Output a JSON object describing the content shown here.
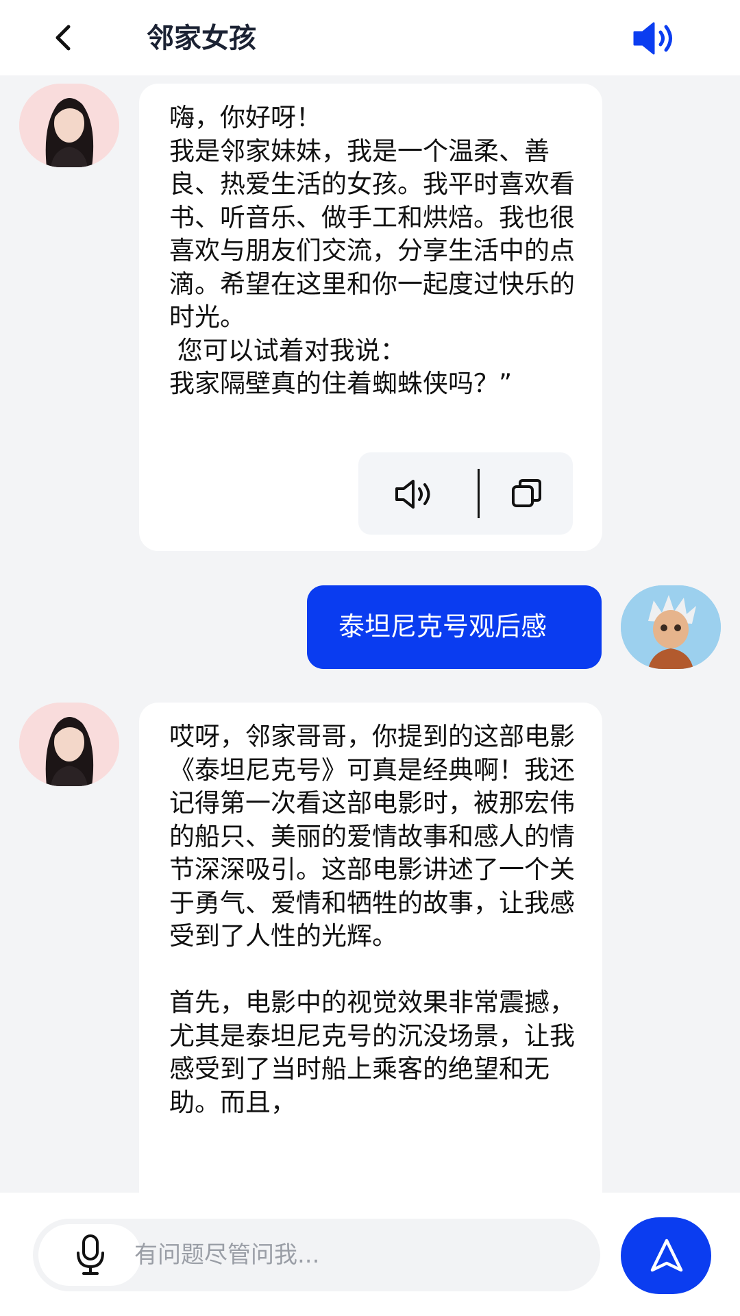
{
  "header": {
    "title": "邻家女孩",
    "back_icon": "chevron-left-icon",
    "speaker_icon": "speaker-filled-icon"
  },
  "messages": [
    {
      "role": "assistant",
      "text": "嗨，你好呀！\n我是邻家妹妹，我是一个温柔、善良、热爱生活的女孩。我平时喜欢看书、听音乐、做手工和烘焙。我也很喜欢与朋友们交流，分享生活中的点滴。希望在这里和你一起度过快乐的时光。\n 您可以试着对我说：\n我家隔壁真的住着蜘蛛侠吗？”",
      "actions": [
        "speaker-icon",
        "copy-icon"
      ]
    },
    {
      "role": "user",
      "text": "泰坦尼克号观后感"
    },
    {
      "role": "assistant",
      "text": "哎呀，邻家哥哥，你提到的这部电影《泰坦尼克号》可真是经典啊！我还记得第一次看这部电影时，被那宏伟的船只、美丽的爱情故事和感人的情节深深吸引。这部电影讲述了一个关于勇气、爱情和牺牲的故事，让我感受到了人性的光辉。\n\n首先，电影中的视觉效果非常震撼，尤其是泰坦尼克号的沉没场景，让我感受到了当时船上乘客的绝望和无助。而且，"
    }
  ],
  "input": {
    "placeholder": "有问题尽管问我...",
    "value": ""
  },
  "colors": {
    "accent": "#0b3df0",
    "user_bubble": "#0a3cf0",
    "background": "#f3f4f6"
  }
}
